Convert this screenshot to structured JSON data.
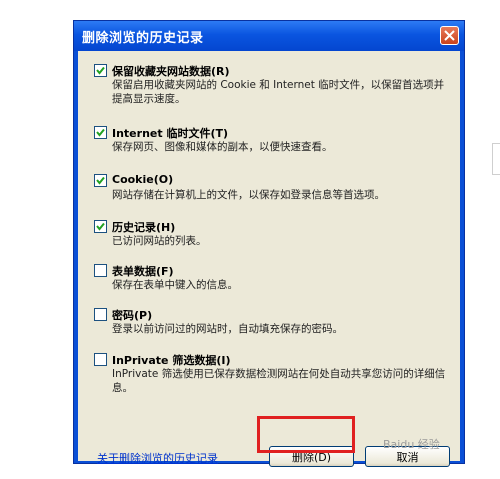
{
  "dialog": {
    "title": "删除浏览的历史记录",
    "options": [
      {
        "label": "保留收藏夹网站数据(R)",
        "checked": true,
        "desc": "保留启用收藏夹网站的 Cookie 和 Internet 临时文件，以保留首选项并提高显示速度。"
      },
      {
        "label": "Internet 临时文件(T)",
        "checked": true,
        "desc": "保存网页、图像和媒体的副本，以便快速查看。"
      },
      {
        "label": "Cookie(O)",
        "checked": true,
        "desc": "网站存储在计算机上的文件，以保存如登录信息等首选项。"
      },
      {
        "label": "历史记录(H)",
        "checked": true,
        "desc": "已访问网站的列表。"
      },
      {
        "label": "表单数据(F)",
        "checked": false,
        "desc": "保存在表单中键入的信息。"
      },
      {
        "label": "密码(P)",
        "checked": false,
        "desc": "登录以前访问过的网站时，自动填充保存的密码。"
      },
      {
        "label": "InPrivate 筛选数据(I)",
        "checked": false,
        "desc": "InPrivate 筛选使用已保存数据检测网站在何处自动共享您访问的详细信息。"
      }
    ],
    "about_link": "关于删除浏览的历史记录",
    "delete_label": "删除(D)",
    "cancel_label": "取消"
  },
  "watermark": "Baidu 经验",
  "colors": {
    "titlebar": "#0a55e0",
    "client_bg": "#ece9d8",
    "highlight": "#e02020",
    "link": "#0033cc"
  }
}
